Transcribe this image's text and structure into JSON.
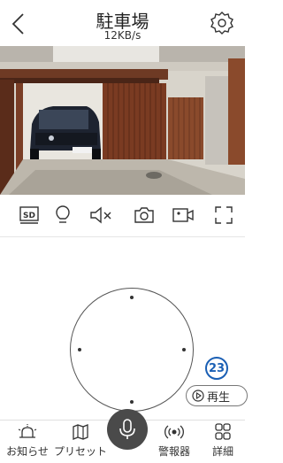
{
  "header": {
    "title": "駐車場",
    "bitrate": "12KB/s"
  },
  "toolbar": {
    "sd_label": "SD"
  },
  "badge": {
    "number": "23"
  },
  "playback": {
    "label": "再生"
  },
  "bottom_nav": {
    "notifications": "お知らせ",
    "presets": "プリセット",
    "alarm": "警報器",
    "details": "詳細"
  },
  "icons": [
    "back-icon",
    "gear-icon",
    "sd-card-icon",
    "lightbulb-icon",
    "speaker-muted-icon",
    "camera-icon",
    "video-record-icon",
    "fullscreen-icon",
    "playback-icon",
    "bell-icon",
    "map-icon",
    "microphone-icon",
    "alarm-icon",
    "grid-icon"
  ],
  "colors": {
    "badge": "#1a5fb4",
    "mic_button": "#4a4a4a"
  }
}
